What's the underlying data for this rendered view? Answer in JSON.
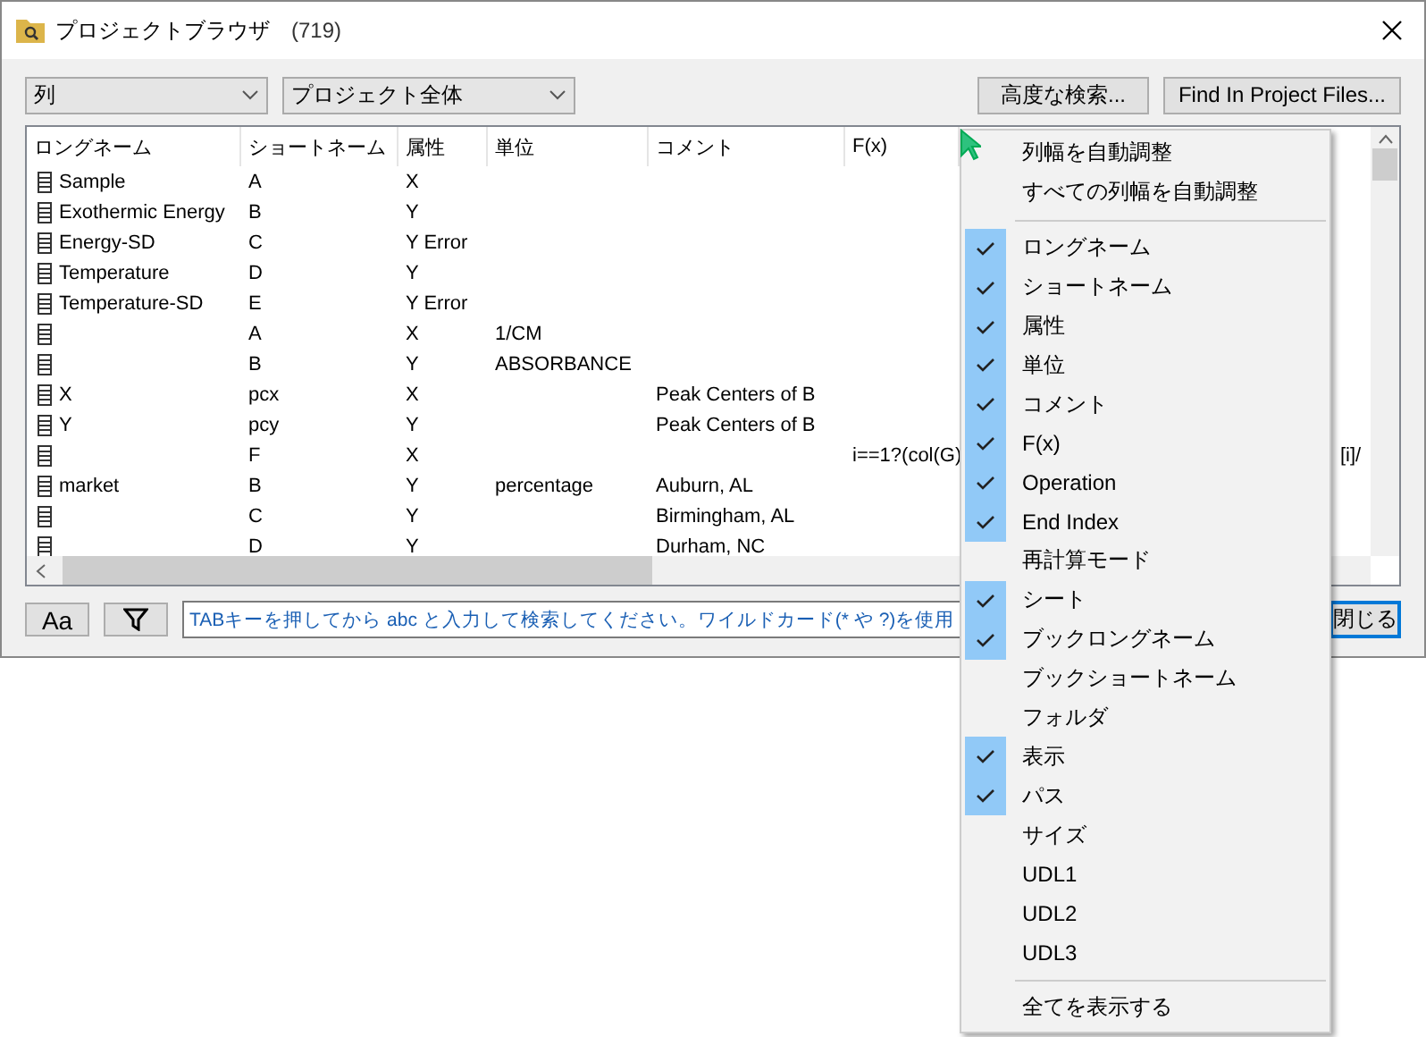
{
  "window": {
    "title": "プロジェクトブラウザ",
    "count": "(719)"
  },
  "toolbar": {
    "type_select": "列",
    "scope_select": "プロジェクト全体",
    "buttons": [
      "高度な検索...",
      "Find In Project Files..."
    ]
  },
  "table": {
    "columns": [
      "ロングネーム",
      "ショートネーム",
      "属性",
      "単位",
      "コメント",
      "F(x)"
    ],
    "rows": [
      {
        "cells": [
          "Sample",
          "A",
          "X",
          "",
          "",
          ""
        ]
      },
      {
        "cells": [
          "Exothermic Energy",
          "B",
          "Y",
          "",
          "",
          ""
        ]
      },
      {
        "cells": [
          "Energy-SD",
          "C",
          "Y Error",
          "",
          "",
          ""
        ]
      },
      {
        "cells": [
          "Temperature",
          "D",
          "Y",
          "",
          "",
          ""
        ]
      },
      {
        "cells": [
          "Temperature-SD",
          "E",
          "Y Error",
          "",
          "",
          ""
        ]
      },
      {
        "cells": [
          "",
          "A",
          "X",
          "1/CM",
          "",
          ""
        ]
      },
      {
        "cells": [
          "",
          "B",
          "Y",
          "ABSORBANCE",
          "",
          ""
        ]
      },
      {
        "cells": [
          "X",
          "pcx",
          "X",
          "",
          "Peak Centers of B",
          ""
        ]
      },
      {
        "cells": [
          "Y",
          "pcy",
          "Y",
          "",
          "Peak Centers of B",
          ""
        ]
      },
      {
        "cells": [
          "",
          "F",
          "X",
          "",
          "",
          "i==1?(col(G)"
        ],
        "tail": "[i]/"
      },
      {
        "cells": [
          "market",
          "B",
          "Y",
          "percentage",
          "Auburn, AL",
          ""
        ]
      },
      {
        "cells": [
          "",
          "C",
          "Y",
          "",
          "Birmingham, AL",
          ""
        ]
      },
      {
        "cells": [
          "",
          "D",
          "Y",
          "",
          "Durham, NC",
          ""
        ]
      }
    ]
  },
  "bottom": {
    "case_button": "Aa",
    "search": {
      "placeholder": "TABキーを押してから abc と入力して検索してください。ワイルドカード(* や ?)を使用"
    },
    "close_button": "閉じる"
  },
  "context_menu": {
    "items": [
      {
        "kind": "plain",
        "label": "列幅を自動調整"
      },
      {
        "kind": "plain",
        "label": "すべての列幅を自動調整"
      },
      {
        "kind": "separator"
      },
      {
        "kind": "check",
        "label": "ロングネーム",
        "checked": true
      },
      {
        "kind": "check",
        "label": "ショートネーム",
        "checked": true
      },
      {
        "kind": "check",
        "label": "属性",
        "checked": true
      },
      {
        "kind": "check",
        "label": "単位",
        "checked": true
      },
      {
        "kind": "check",
        "label": "コメント",
        "checked": true
      },
      {
        "kind": "check",
        "label": "F(x)",
        "checked": true
      },
      {
        "kind": "check",
        "label": "Operation",
        "checked": true
      },
      {
        "kind": "check",
        "label": "End Index",
        "checked": true
      },
      {
        "kind": "check",
        "label": "再計算モード",
        "checked": false
      },
      {
        "kind": "check",
        "label": "シート",
        "checked": true
      },
      {
        "kind": "check",
        "label": "ブックロングネーム",
        "checked": true
      },
      {
        "kind": "check",
        "label": "ブックショートネーム",
        "checked": false
      },
      {
        "kind": "check",
        "label": "フォルダ",
        "checked": false
      },
      {
        "kind": "check",
        "label": "表示",
        "checked": true
      },
      {
        "kind": "check",
        "label": "パス",
        "checked": true
      },
      {
        "kind": "check",
        "label": "サイズ",
        "checked": false
      },
      {
        "kind": "check",
        "label": "UDL1",
        "checked": false
      },
      {
        "kind": "check",
        "label": "UDL2",
        "checked": false
      },
      {
        "kind": "check",
        "label": "UDL3",
        "checked": false
      },
      {
        "kind": "separator"
      },
      {
        "kind": "plain",
        "label": "全てを表示する"
      }
    ]
  }
}
